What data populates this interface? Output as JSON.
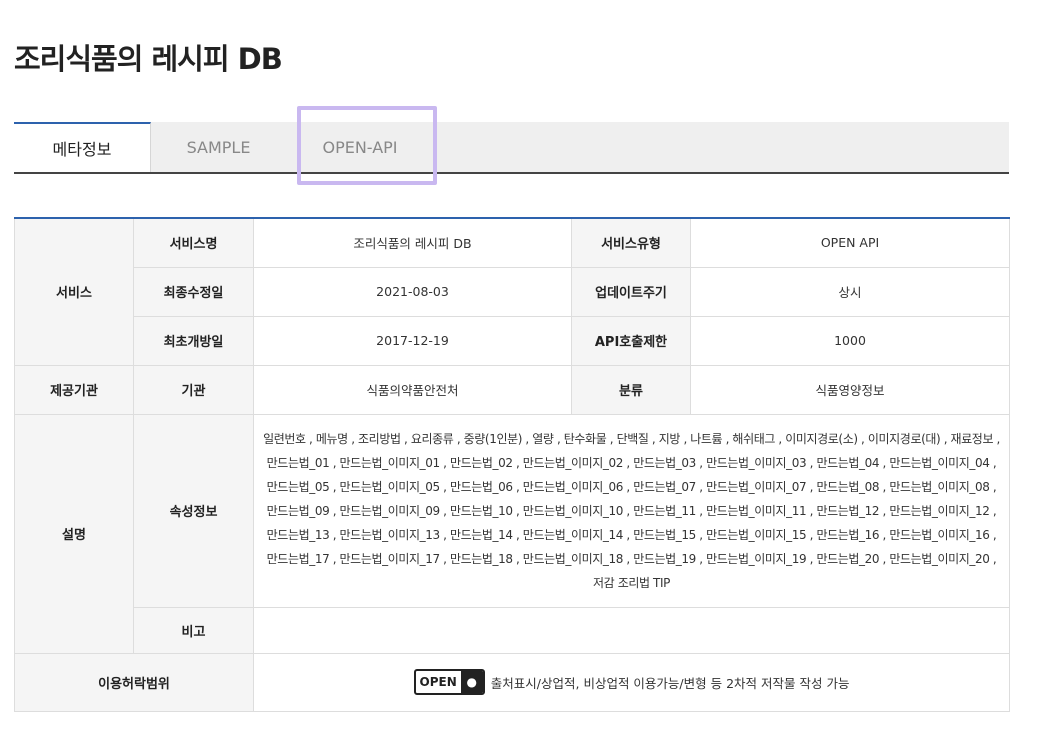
{
  "page": {
    "title": "조리식품의 레시피 DB"
  },
  "tabs": [
    {
      "label": "메타정보",
      "active": true
    },
    {
      "label": "SAMPLE",
      "active": false
    },
    {
      "label": "OPEN-API",
      "active": false
    }
  ],
  "colors": {
    "accent": "#2d62ad",
    "highlight": "#c9b8f0",
    "header_bg": "#f5f5f5",
    "tab_bg": "#efefef"
  },
  "table": {
    "service_group": "서비스",
    "service_name_label": "서비스명",
    "service_name": "조리식품의 레시피 DB",
    "service_type_label": "서비스유형",
    "service_type": "OPEN API",
    "last_modified_label": "최종수정일",
    "last_modified": "2021-08-03",
    "update_cycle_label": "업데이트주기",
    "update_cycle": "상시",
    "first_open_label": "최초개방일",
    "first_open": "2017-12-19",
    "api_limit_label": "API호출제한",
    "api_limit": "1000",
    "provider_group": "제공기관",
    "org_label": "기관",
    "org": "식품의약품안전처",
    "category_label": "분류",
    "category": "식품영양정보",
    "desc_group": "설명",
    "attr_label": "속성정보",
    "attr_text": "일련번호 , 메뉴명 , 조리방법 , 요리종류 , 중량(1인분) , 열량 , 탄수화물 , 단백질 , 지방 , 나트륨 , 해쉬태그 , 이미지경로(소) , 이미지경로(대) , 재료정보 , 만드는법_01 , 만드는법_이미지_01 , 만드는법_02 , 만드는법_이미지_02 , 만드는법_03 , 만드는법_이미지_03 , 만드는법_04 , 만드는법_이미지_04 , 만드는법_05 , 만드는법_이미지_05 , 만드는법_06 , 만드는법_이미지_06 , 만드는법_07 , 만드는법_이미지_07 , 만드는법_08 , 만드는법_이미지_08 , 만드는법_09 , 만드는법_이미지_09 , 만드는법_10 , 만드는법_이미지_10 , 만드는법_11 , 만드는법_이미지_11 , 만드는법_12 , 만드는법_이미지_12 , 만드는법_13 , 만드는법_이미지_13 , 만드는법_14 , 만드는법_이미지_14 , 만드는법_15 , 만드는법_이미지_15 , 만드는법_16 , 만드는법_이미지_16 , 만드는법_17 , 만드는법_이미지_17 , 만드는법_18 , 만드는법_이미지_18 , 만드는법_19 , 만드는법_이미지_19 , 만드는법_20 , 만드는법_이미지_20 , 저감 조리법 TIP",
    "note_label": "비고",
    "note": "",
    "license_label": "이용허락범위",
    "license_badge": "OPEN",
    "license_text": "출처표시/상업적, 비상업적 이용가능/변형 등 2차적 저작물 작성 가능"
  }
}
